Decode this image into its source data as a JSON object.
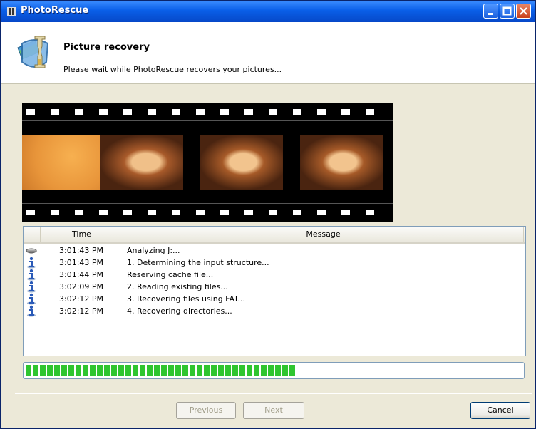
{
  "window": {
    "title": "PhotoRescue"
  },
  "header": {
    "title": "Picture recovery",
    "subtitle": "Please wait while PhotoRescue recovers your pictures..."
  },
  "log": {
    "columns": [
      "Time",
      "Message"
    ],
    "rows": [
      {
        "icon": "disk-drive-icon",
        "time": "3:01:43 PM",
        "message": "Analyzing J:..."
      },
      {
        "icon": "info-icon",
        "time": "3:01:43 PM",
        "message": "1. Determining the input structure..."
      },
      {
        "icon": "info-icon",
        "time": "3:01:44 PM",
        "message": "Reserving cache file..."
      },
      {
        "icon": "info-icon",
        "time": "3:02:09 PM",
        "message": "2. Reading existing files..."
      },
      {
        "icon": "info-icon",
        "time": "3:02:12 PM",
        "message": "3. Recovering files using FAT..."
      },
      {
        "icon": "info-icon",
        "time": "3:02:12 PM",
        "message": "4. Recovering directories..."
      }
    ]
  },
  "progress": {
    "fraction": 0.545,
    "color": "#2fc52f"
  },
  "buttons": {
    "previous": "Previous",
    "next": "Next",
    "cancel": "Cancel"
  }
}
